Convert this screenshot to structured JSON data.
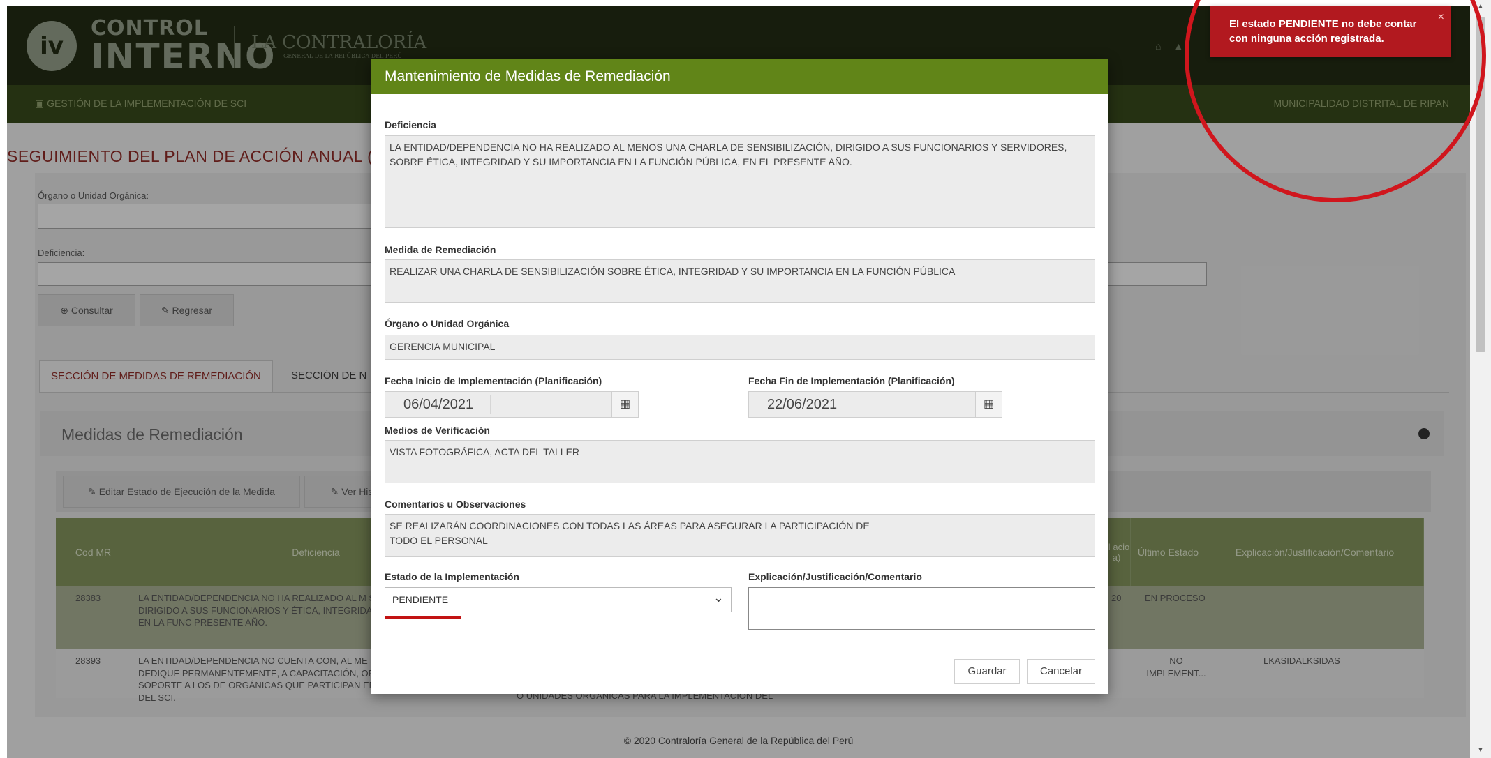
{
  "brand": {
    "logo_icon": "iv",
    "line1": "CONTROL",
    "line2": "INTERNO",
    "org": "LA CONTRALORÍA",
    "org_sub": "GENERAL DE LA REPÚBLICA DEL PERÚ"
  },
  "nav": {
    "left": "GESTIÓN DE LA IMPLEMENTACIÓN DE SCI",
    "right": "MUNICIPALIDAD DISTRITAL DE RIPAN"
  },
  "page": {
    "title": "SEGUIMIENTO DEL PLAN DE ACCIÓN ANUAL (NI",
    "organo_label": "Órgano o Unidad Orgánica:",
    "deficiencia_label": "Deficiencia:",
    "consultar": "Consultar",
    "regresar": "Regresar",
    "tab_active": "SECCIÓN DE MEDIDAS DE REMEDIACIÓN",
    "tab_other": "SECCIÓN DE N",
    "medidas_title": "Medidas de Remediación",
    "btn_editar": "Editar Estado de Ejecución de la Medida",
    "btn_ver": "Ver Hist",
    "footer": "© 2020 Contraloría General de la República del Perú"
  },
  "table": {
    "headers": [
      "Cod MR",
      "Deficiencia",
      "al acio a)",
      "Último Estado",
      "Explicación/Justificación/Comentario"
    ],
    "rows": [
      {
        "cod": "28383",
        "deficiencia": "LA ENTIDAD/DEPENDENCIA NO HA REALIZADO AL M SENSIBILIZACIÓN, DIRIGIDO A SUS FUNCIONARIOS Y ÉTICA, INTEGRIDAD Y SU IMPORTANCIA EN LA FUNC PRESENTE AÑO.",
        "col_frag": "20",
        "estado": "EN PROCESO",
        "explicacion": ""
      },
      {
        "cod": "28393",
        "deficiencia": "LA ENTIDAD/DEPENDENCIA NO CUENTA CON, AL ME SERVIDOR QUE SE DEDIQUE PERMANENTEMENTE, A CAPACITACIÓN, ORIENTACIÓN Y SOPORTE A LOS DE ORGÁNICAS QUE PARTICIPAN EN LA IMPLEMENTACIÓN DEL SCI.",
        "medida_frag": "O UNIDADES ORGÁNICAS PARA LA IMPLEMENTACIÓN DEL",
        "estado": "NO IMPLEMENT...",
        "explicacion": "LKASIDALKSIDAS"
      }
    ]
  },
  "modal": {
    "title": "Mantenimiento de Medidas de Remediación",
    "deficiencia_label": "Deficiencia",
    "deficiencia_text": "LA ENTIDAD/DEPENDENCIA NO HA REALIZADO AL MENOS UNA CHARLA DE SENSIBILIZACIÓN, DIRIGIDO A SUS FUNCIONARIOS Y SERVIDORES, SOBRE ÉTICA, INTEGRIDAD Y SU IMPORTANCIA EN LA FUNCIÓN PÚBLICA, EN EL PRESENTE AÑO.",
    "medida_label": "Medida de Remediación",
    "medida_text": "REALIZAR UNA CHARLA DE SENSIBILIZACIÓN SOBRE ÉTICA, INTEGRIDAD Y SU IMPORTANCIA EN LA FUNCIÓN PÚBLICA",
    "organo_label": "Órgano o Unidad Orgánica",
    "organo_text": "GERENCIA MUNICIPAL",
    "fecha_inicio_label": "Fecha Inicio de Implementación (Planificación)",
    "fecha_inicio": "06/04/2021",
    "fecha_fin_label": "Fecha Fin de Implementación (Planificación)",
    "fecha_fin": "22/06/2021",
    "medios_label": "Medios de Verificación",
    "medios_text": "VISTA FOTOGRÁFICA, ACTA DEL TALLER",
    "comentarios_label": "Comentarios u Observaciones",
    "comentarios_line1": "SE REALIZARÁN COORDINACIONES CON TODAS LAS ÁREAS PARA ASEGURAR LA PARTICIPACIÓN DE",
    "comentarios_line2": "TODO EL PERSONAL",
    "estado_label": "Estado de la Implementación",
    "estado_value": "PENDIENTE",
    "explicacion_label": "Explicación/Justificación/Comentario",
    "explicacion_value": "",
    "guardar": "Guardar",
    "cancelar": "Cancelar"
  },
  "toast": {
    "message": "El estado PENDIENTE no debe contar con ninguna acción registrada.",
    "close": "×"
  },
  "colors": {
    "modal_header": "#618518",
    "toast": "#b2191f",
    "annotation_circle": "#d0161d",
    "title_red": "#8a2a26"
  }
}
